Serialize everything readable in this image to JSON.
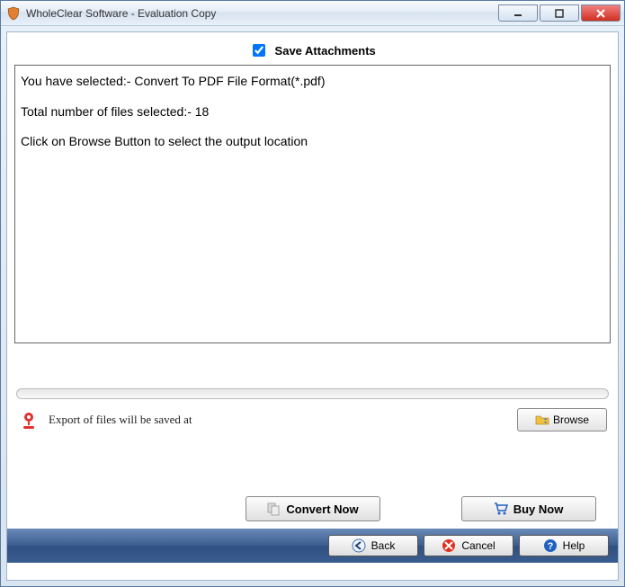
{
  "window": {
    "title": "WholeClear Software - Evaluation Copy"
  },
  "checkbox": {
    "save_attachments_label": "Save Attachments",
    "save_attachments_checked": true
  },
  "info": {
    "line1": "You have selected:- Convert To PDF File Format(*.pdf)",
    "line2": "Total number of files selected:- 18",
    "line3": "Click on Browse Button to select the output location"
  },
  "export": {
    "label": "Export of files will be saved at",
    "browse_label": "Browse"
  },
  "actions": {
    "convert_label": "Convert Now",
    "buy_label": "Buy Now"
  },
  "footer": {
    "back_label": "Back",
    "cancel_label": "Cancel",
    "help_label": "Help"
  }
}
